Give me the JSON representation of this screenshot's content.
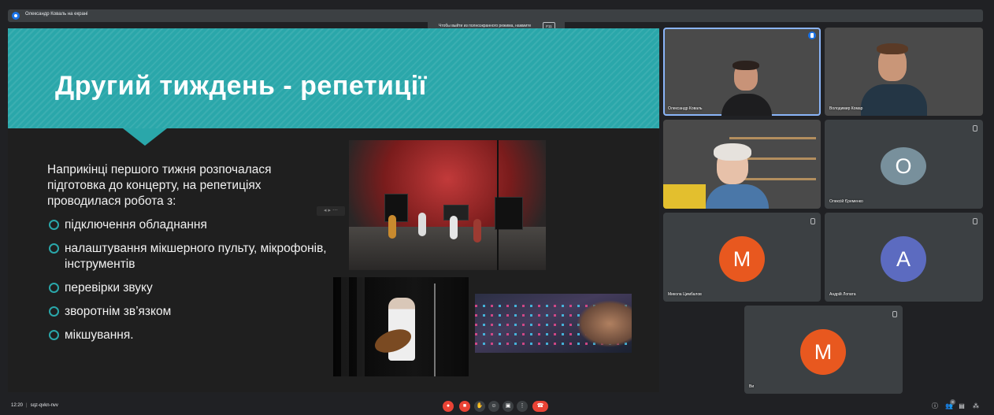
{
  "topbar": {
    "presenter_text": "Олександр Коваль на екрані"
  },
  "fullscreen_hint": {
    "text": "Чтобы выйти из полноэкранного режима, нажмите",
    "key": "F11"
  },
  "slide": {
    "title": "Другий тиждень - репетиції",
    "intro": "Наприкінці першого тижня розпочалася підготовка до концерту, на репетиціях проводилася робота з:",
    "bullets": [
      "підключення обладнання",
      "налаштування мікшерного пульту, мікрофонів, інструментів",
      "перевірки звуку",
      "зворотнім зв’язком",
      "мікшування."
    ],
    "accent_color": "#2aa7aa"
  },
  "participants": [
    {
      "name": "Олександр Коваль",
      "type": "video",
      "speaking": true
    },
    {
      "name": "Володимир Комар",
      "type": "video"
    },
    {
      "name": "",
      "type": "video"
    },
    {
      "name": "Олексій Єременко",
      "type": "avatar",
      "initial": "О",
      "color": "#78909c"
    },
    {
      "name": "Микола Цимбалов",
      "type": "avatar",
      "initial": "М",
      "color": "#e8581f"
    },
    {
      "name": "Андрій Лопата",
      "type": "avatar",
      "initial": "А",
      "color": "#5c6bc0"
    },
    {
      "name": "Ви",
      "type": "avatar",
      "initial": "М",
      "color": "#e8581f"
    }
  ],
  "bottom": {
    "time": "12:20",
    "meeting_code": "sqz-qvkn-nvv",
    "participant_count": "8",
    "controls": [
      "mic-off-icon",
      "camera-off-icon",
      "raise-hand-icon",
      "emoji-icon",
      "present-icon",
      "more-options-icon",
      "end-call-icon"
    ],
    "right": [
      "info-icon",
      "people-icon",
      "chat-icon",
      "activities-icon"
    ]
  }
}
